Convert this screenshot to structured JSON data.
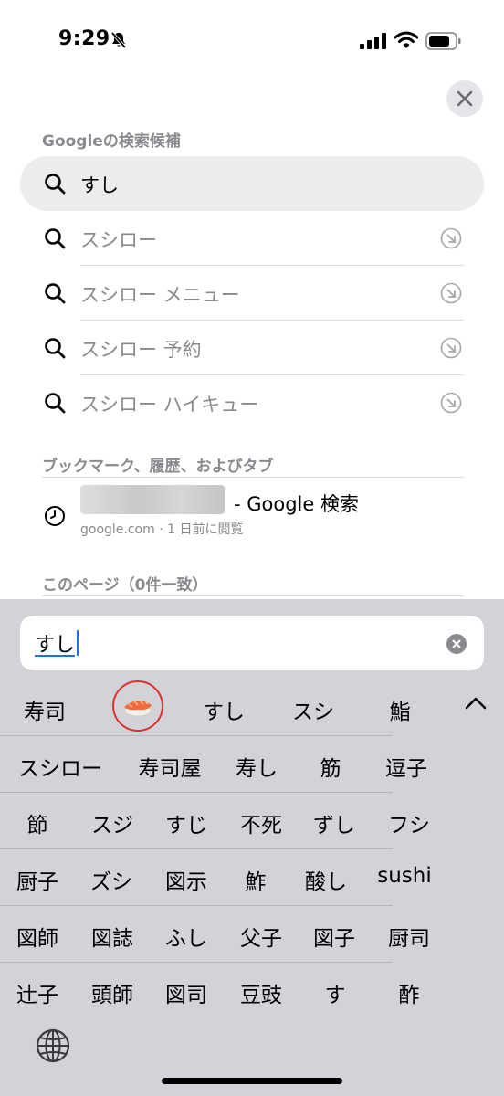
{
  "status_bar": {
    "time": "9:29"
  },
  "suggestions_section_title": "Googleの検索候補",
  "suggestions": [
    {
      "text": "すし",
      "active": true
    },
    {
      "text": "スシロー"
    },
    {
      "text": "スシロー メニュー"
    },
    {
      "text": "スシロー 予約"
    },
    {
      "text": "スシロー ハイキュー"
    }
  ],
  "bookmarks_section_title": "ブックマーク、履歴、およびタブ",
  "history_item": {
    "title_suffix": "- Google 検索",
    "subtitle": "google.com · 1 日前に閲覧"
  },
  "this_page_section_title": "このページ（0件一致）",
  "search_field": {
    "value": "すし"
  },
  "candidates_row1": [
    "寿司",
    "すし",
    "スシ",
    "鮨"
  ],
  "candidates_grid": [
    [
      "スシロー",
      "寿司屋",
      "寿し",
      "筋",
      "逗子"
    ],
    [
      "節",
      "スジ",
      "すじ",
      "不死",
      "ずし",
      "フシ"
    ],
    [
      "厨子",
      "ズシ",
      "図示",
      "鮓",
      "酸し",
      "sushi"
    ],
    [
      "図師",
      "図誌",
      "ふし",
      "父子",
      "図子",
      "厨司"
    ],
    [
      "辻子",
      "頭師",
      "図司",
      "豆豉",
      "す",
      "酢"
    ]
  ],
  "colors": {
    "accent": "#1e6fe8",
    "highlight_circle": "#e0302a",
    "keyboard_bg": "#d1d3d9"
  },
  "icons": [
    "bell-slash-icon",
    "signal-icon",
    "wifi-icon",
    "battery-icon",
    "close-icon",
    "search-icon",
    "arrow-up-left-icon",
    "clock-icon",
    "clear-icon",
    "sushi-emoji-icon",
    "chevron-up-icon",
    "globe-icon"
  ]
}
